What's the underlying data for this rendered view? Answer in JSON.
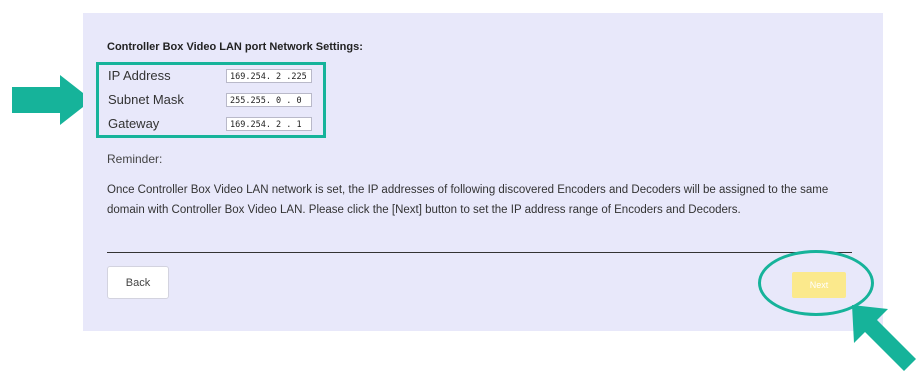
{
  "section_title": "Controller Box Video LAN port Network Settings:",
  "fields": [
    {
      "label": "IP Address",
      "value": "169.254. 2 .225"
    },
    {
      "label": "Subnet Mask",
      "value": "255.255. 0 . 0"
    },
    {
      "label": "Gateway",
      "value": "169.254. 2 . 1"
    }
  ],
  "reminder": {
    "title": "Reminder:",
    "text": "Once Controller Box Video LAN network is set, the IP addresses of following discovered Encoders and Decoders will be assigned to the same domain with Controller Box Video LAN. Please click the [Next] button to set the IP address range of Encoders and Decoders."
  },
  "buttons": {
    "back": "Back",
    "next": "Next"
  },
  "colors": {
    "highlight": "#16b39a",
    "panel_bg": "#e8e8fa",
    "next_button": "#fbe98c"
  }
}
